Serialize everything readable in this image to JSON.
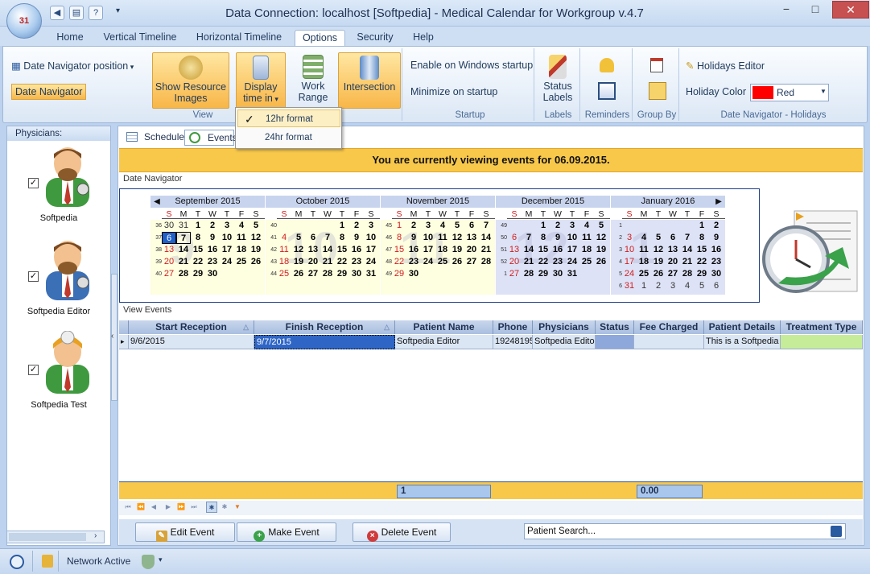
{
  "window": {
    "title": "Data Connection: localhost [Softpedia] - Medical Calendar for Workgroup v.4.7",
    "minimize": "−",
    "maximize": "□",
    "close": "✕"
  },
  "ribbon_tabs": [
    "Home",
    "Vertical Timeline",
    "Horizontal Timeline",
    "Options",
    "Security",
    "Help"
  ],
  "ribbon": {
    "date_nav_position": "Date Navigator position",
    "date_navigator": "Date Navigator",
    "show_resource_images": "Show Resource Images",
    "display_time_in": "Display time in",
    "work_range": "Work Range",
    "intersection": "Intersection",
    "group_view": "View",
    "enable_startup": "Enable on Windows startup",
    "minimize_startup": "Minimize on startup",
    "group_startup": "Startup",
    "status_labels": "Status Labels",
    "group_labels": "Labels",
    "group_reminders": "Reminders",
    "group_groupby": "Group By",
    "holidays_editor": "Holidays Editor",
    "holiday_color_label": "Holiday Color",
    "holiday_color_value": "Red",
    "holiday_color_hex": "#ff0000",
    "group_datenav_holidays": "Date Navigator - Holidays"
  },
  "dropdown": {
    "items": [
      {
        "label": "12hr format",
        "checked": true
      },
      {
        "label": "24hr format",
        "checked": false
      }
    ]
  },
  "physicians": {
    "header": "Physicians:",
    "items": [
      {
        "name": "Softpedia",
        "checked": true
      },
      {
        "name": "Softpedia Editor",
        "checked": true
      },
      {
        "name": "Softpedia Test",
        "checked": true
      }
    ]
  },
  "view_tabs": [
    "Scheduler",
    "Events"
  ],
  "banner": "You are currently viewing events for 06.09.2015.",
  "date_navigator_label": "Date Navigator",
  "calendar": {
    "day_headers": [
      "S",
      "M",
      "T",
      "W",
      "T",
      "F",
      "S"
    ],
    "months": [
      {
        "name": "September 2015",
        "watermark": "9",
        "weeks": [
          "36",
          "37",
          "38",
          "39",
          "40"
        ],
        "lead": [
          {
            "d": "30"
          },
          {
            "d": "31"
          }
        ],
        "start": 2,
        "count": 30
      },
      {
        "name": "October 2015",
        "watermark": "10",
        "weeks": [
          "40",
          "41",
          "42",
          "43",
          "44"
        ],
        "start": 4,
        "count": 31
      },
      {
        "name": "November 2015",
        "watermark": "11",
        "weeks": [
          "45",
          "46",
          "47",
          "48",
          "49"
        ],
        "start": 0,
        "count": 30
      },
      {
        "name": "December 2015",
        "watermark": "12",
        "weeks": [
          "49",
          "50",
          "51",
          "52",
          "1"
        ],
        "start": 2,
        "count": 31
      },
      {
        "name": "January 2016",
        "watermark": "1",
        "weeks": [
          "1",
          "2",
          "3",
          "4",
          "5",
          "6"
        ],
        "start": 5,
        "count": 31,
        "trail": [
          "1",
          "2",
          "3",
          "4",
          "5",
          "6"
        ]
      }
    ]
  },
  "view_events_label": "View Events",
  "grid": {
    "columns": [
      "Start Reception",
      "Finish Reception",
      "Patient Name",
      "Phone",
      "Physicians",
      "Status",
      "Fee Charged",
      "Patient Details",
      "Treatment Type"
    ],
    "rows": [
      [
        "9/6/2015",
        "9/7/2015",
        "Softpedia Editor",
        "19248195",
        "Softpedia Edito",
        "",
        "",
        "This is a Softpedia",
        ""
      ]
    ],
    "summary": {
      "count": "1",
      "fee": "0.00"
    }
  },
  "actions": {
    "edit": "Edit Event",
    "make": "Make Event",
    "delete": "Delete Event",
    "search_placeholder": "Patient Search..."
  },
  "status": {
    "network": "Network Active"
  }
}
